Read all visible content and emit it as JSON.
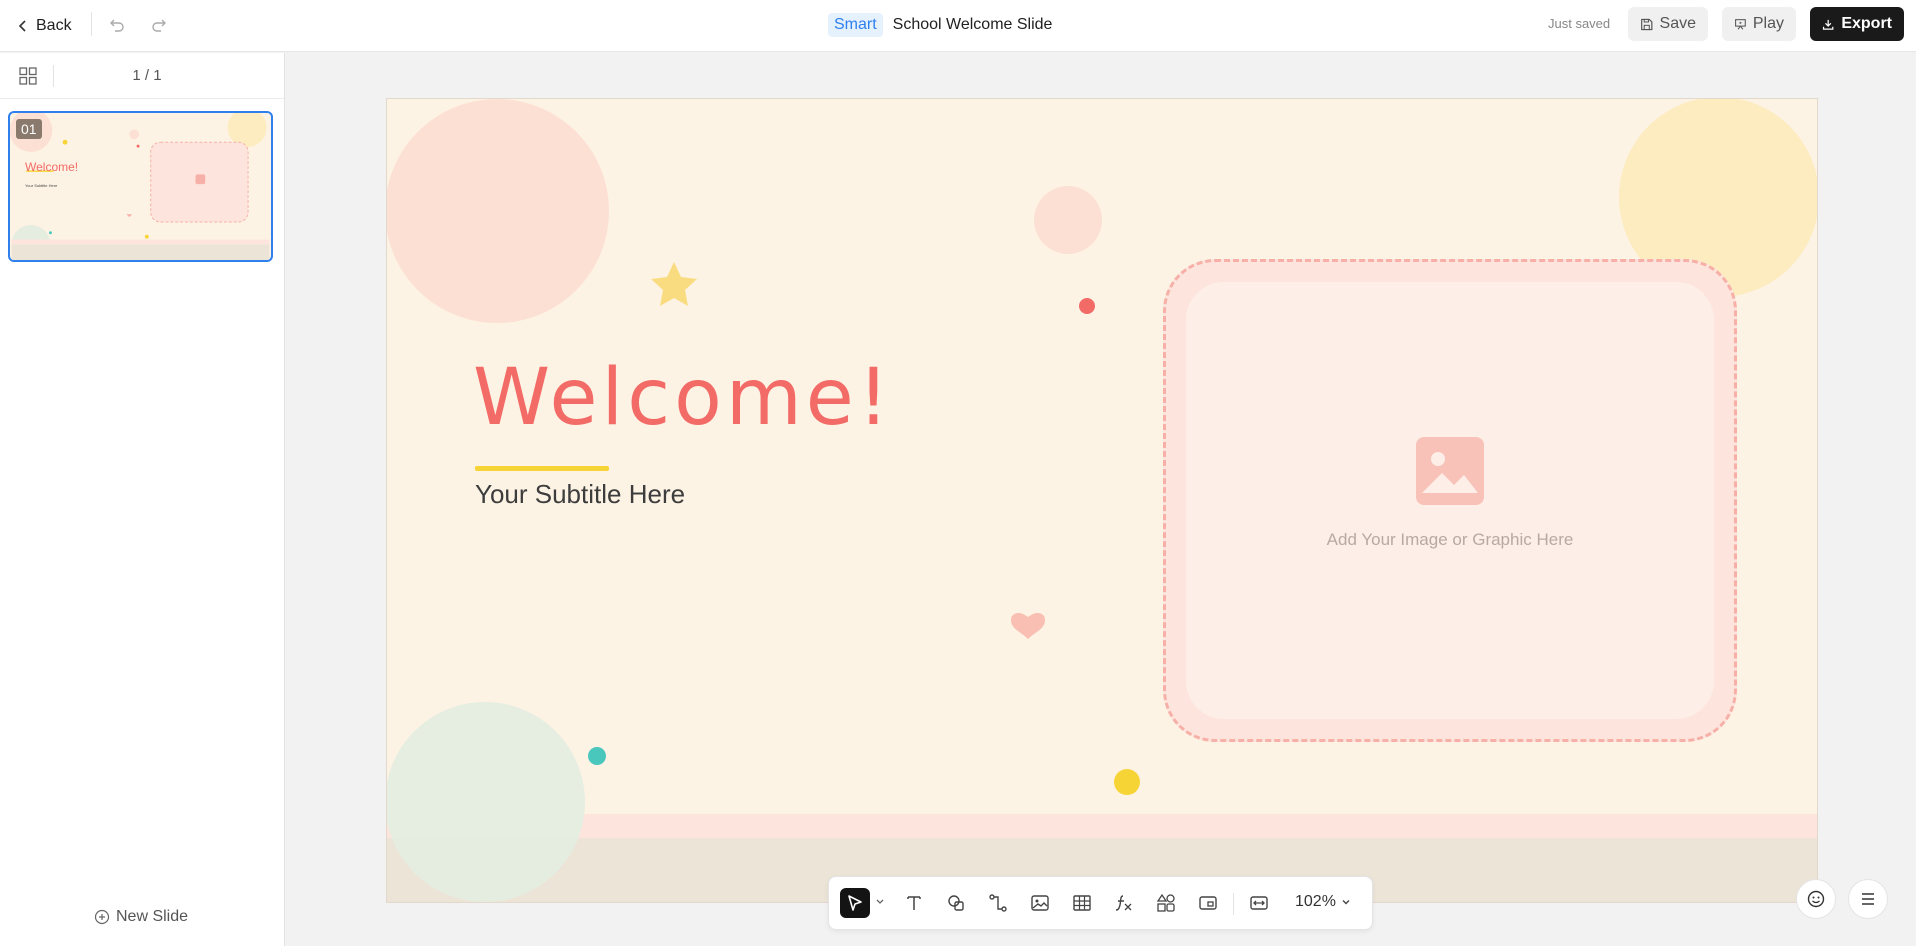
{
  "topbar": {
    "back_label": "Back",
    "smart_badge": "Smart",
    "doc_title": "School Welcome Slide",
    "save_status": "Just saved",
    "save_label": "Save",
    "play_label": "Play",
    "export_label": "Export"
  },
  "left_panel": {
    "page_indicator": "1 / 1",
    "thumbnails": [
      {
        "number": "01",
        "title": "Welcome!",
        "subtitle": "Your Subtitle Here",
        "selected": true
      }
    ],
    "new_slide_label": "New Slide"
  },
  "slide": {
    "title": "Welcome!",
    "subtitle": "Your Subtitle Here",
    "image_placeholder_text": "Add Your Image or Graphic Here",
    "colors": {
      "background": "#fdf3e4",
      "title": "#f26b67",
      "accent_underline": "#f7d436",
      "placeholder_border": "#f6b0a8"
    }
  },
  "toolbar": {
    "tools": [
      {
        "name": "select",
        "icon": "cursor-arrow-icon",
        "active": true
      },
      {
        "name": "text",
        "icon": "text-icon"
      },
      {
        "name": "shapes",
        "icon": "shapes-icon"
      },
      {
        "name": "connector",
        "icon": "connector-icon"
      },
      {
        "name": "image",
        "icon": "image-icon"
      },
      {
        "name": "table",
        "icon": "table-icon"
      },
      {
        "name": "formula",
        "icon": "formula-icon"
      },
      {
        "name": "elements",
        "icon": "elements-icon"
      },
      {
        "name": "embed",
        "icon": "embed-icon"
      },
      {
        "name": "fit-to-screen",
        "icon": "fit-icon"
      }
    ],
    "zoom_level": "102%"
  },
  "corner_buttons": {
    "feedback_icon": "smiley-icon",
    "menu_icon": "hamburger-icon"
  }
}
